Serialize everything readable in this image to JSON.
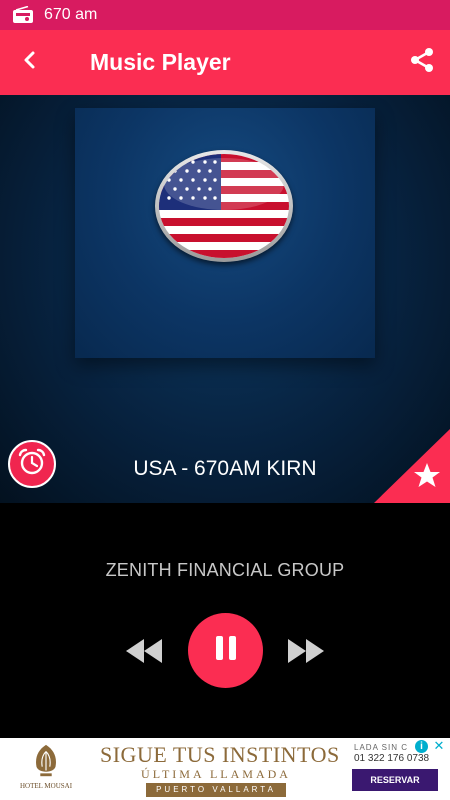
{
  "status_bar": {
    "title": "670 am",
    "icon": "radio-icon"
  },
  "app_bar": {
    "title": "Music Player",
    "back_icon": "chevron-left-icon",
    "share_icon": "share-icon"
  },
  "player": {
    "station": "USA - 670AM KIRN",
    "now_playing": "ZENITH FINANCIAL GROUP",
    "state": "playing",
    "artwork_icon": "usa-flag-icon",
    "timer_icon": "alarm-clock-icon",
    "favorite_icon": "star-icon",
    "rewind_icon": "rewind-icon",
    "pause_icon": "pause-icon",
    "forward_icon": "fast-forward-icon"
  },
  "ad": {
    "logo_text": "HOTEL MOUSAI",
    "headline": "SIGUE TUS INSTINTOS",
    "subline": "ÚLTIMA LLAMADA",
    "location": "PUERTO VALLARTA",
    "call_label": "LADA SIN C",
    "phone": "01 322 176 0738",
    "cta": "RESERVAR"
  },
  "colors": {
    "status_bar": "#d81b60",
    "accent": "#fb2d52",
    "background": "#000000",
    "hero": "#0c3564"
  }
}
